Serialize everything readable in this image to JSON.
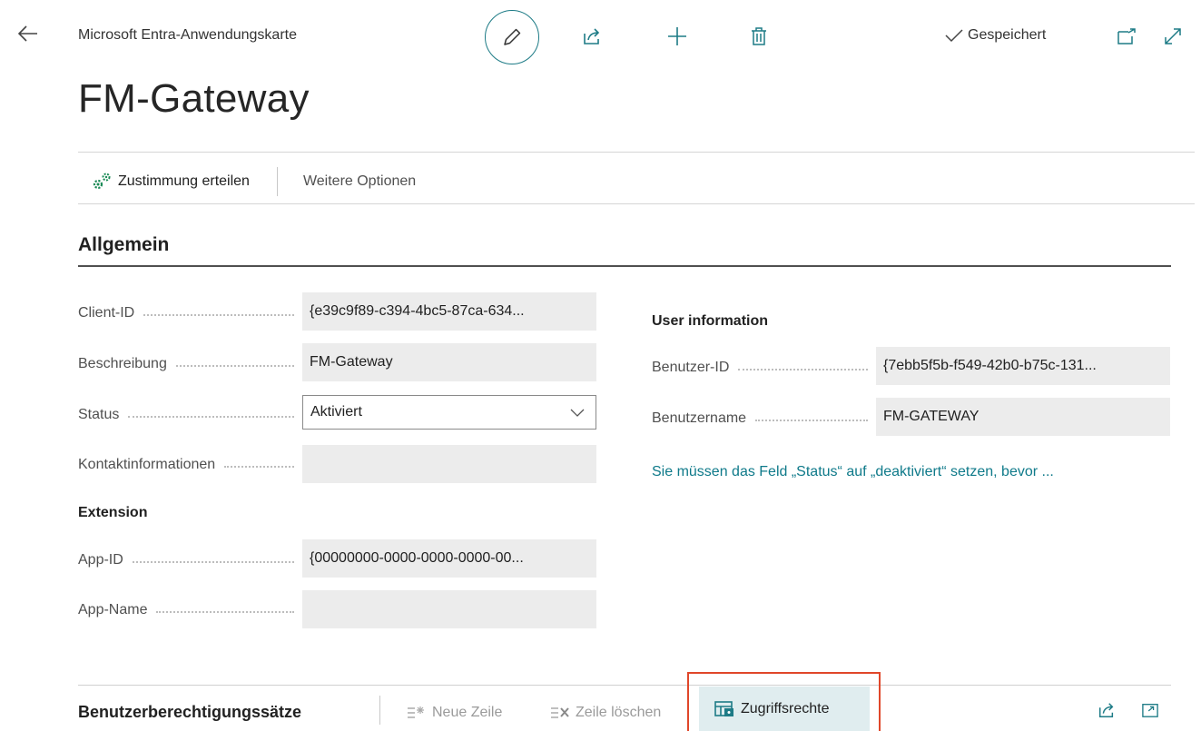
{
  "header": {
    "card_type": "Microsoft Entra-Anwendungskarte",
    "saved_label": "Gespeichert",
    "title": "FM-Gateway",
    "icons": [
      "back-arrow-icon",
      "pencil-icon",
      "share-icon",
      "plus-icon",
      "trash-icon",
      "checkmark-icon",
      "open-new-window-icon",
      "expand-icon"
    ]
  },
  "actions": {
    "grant_consent": "Zustimmung erteilen",
    "more_options": "Weitere Optionen"
  },
  "general": {
    "title": "Allgemein",
    "client_id": {
      "label": "Client-ID",
      "value": "{e39c9f89-c394-4bc5-87ca-634..."
    },
    "description": {
      "label": "Beschreibung",
      "value": "FM-Gateway"
    },
    "status": {
      "label": "Status",
      "value": "Aktiviert"
    },
    "contact": {
      "label": "Kontaktinformationen",
      "value": ""
    },
    "extension_title": "Extension",
    "app_id": {
      "label": "App-ID",
      "value": "{00000000-0000-0000-0000-00..."
    },
    "app_name": {
      "label": "App-Name",
      "value": ""
    },
    "user_info_title": "User information",
    "user_id": {
      "label": "Benutzer-ID",
      "value": "{7ebb5f5b-f549-42b0-b75c-131..."
    },
    "user_name": {
      "label": "Benutzername",
      "value": "FM-GATEWAY"
    },
    "status_hint": "Sie müssen das Feld „Status“ auf „deaktiviert“ setzen, bevor ..."
  },
  "permissions": {
    "title": "Benutzerberechtigungssätze",
    "new_line": "Neue Zeile",
    "delete_line": "Zeile löschen",
    "access_rights": "Zugriffsrechte"
  },
  "colors": {
    "accent": "#0f7a8a",
    "highlight_border": "#e0472a",
    "field_bg": "#ececec"
  }
}
